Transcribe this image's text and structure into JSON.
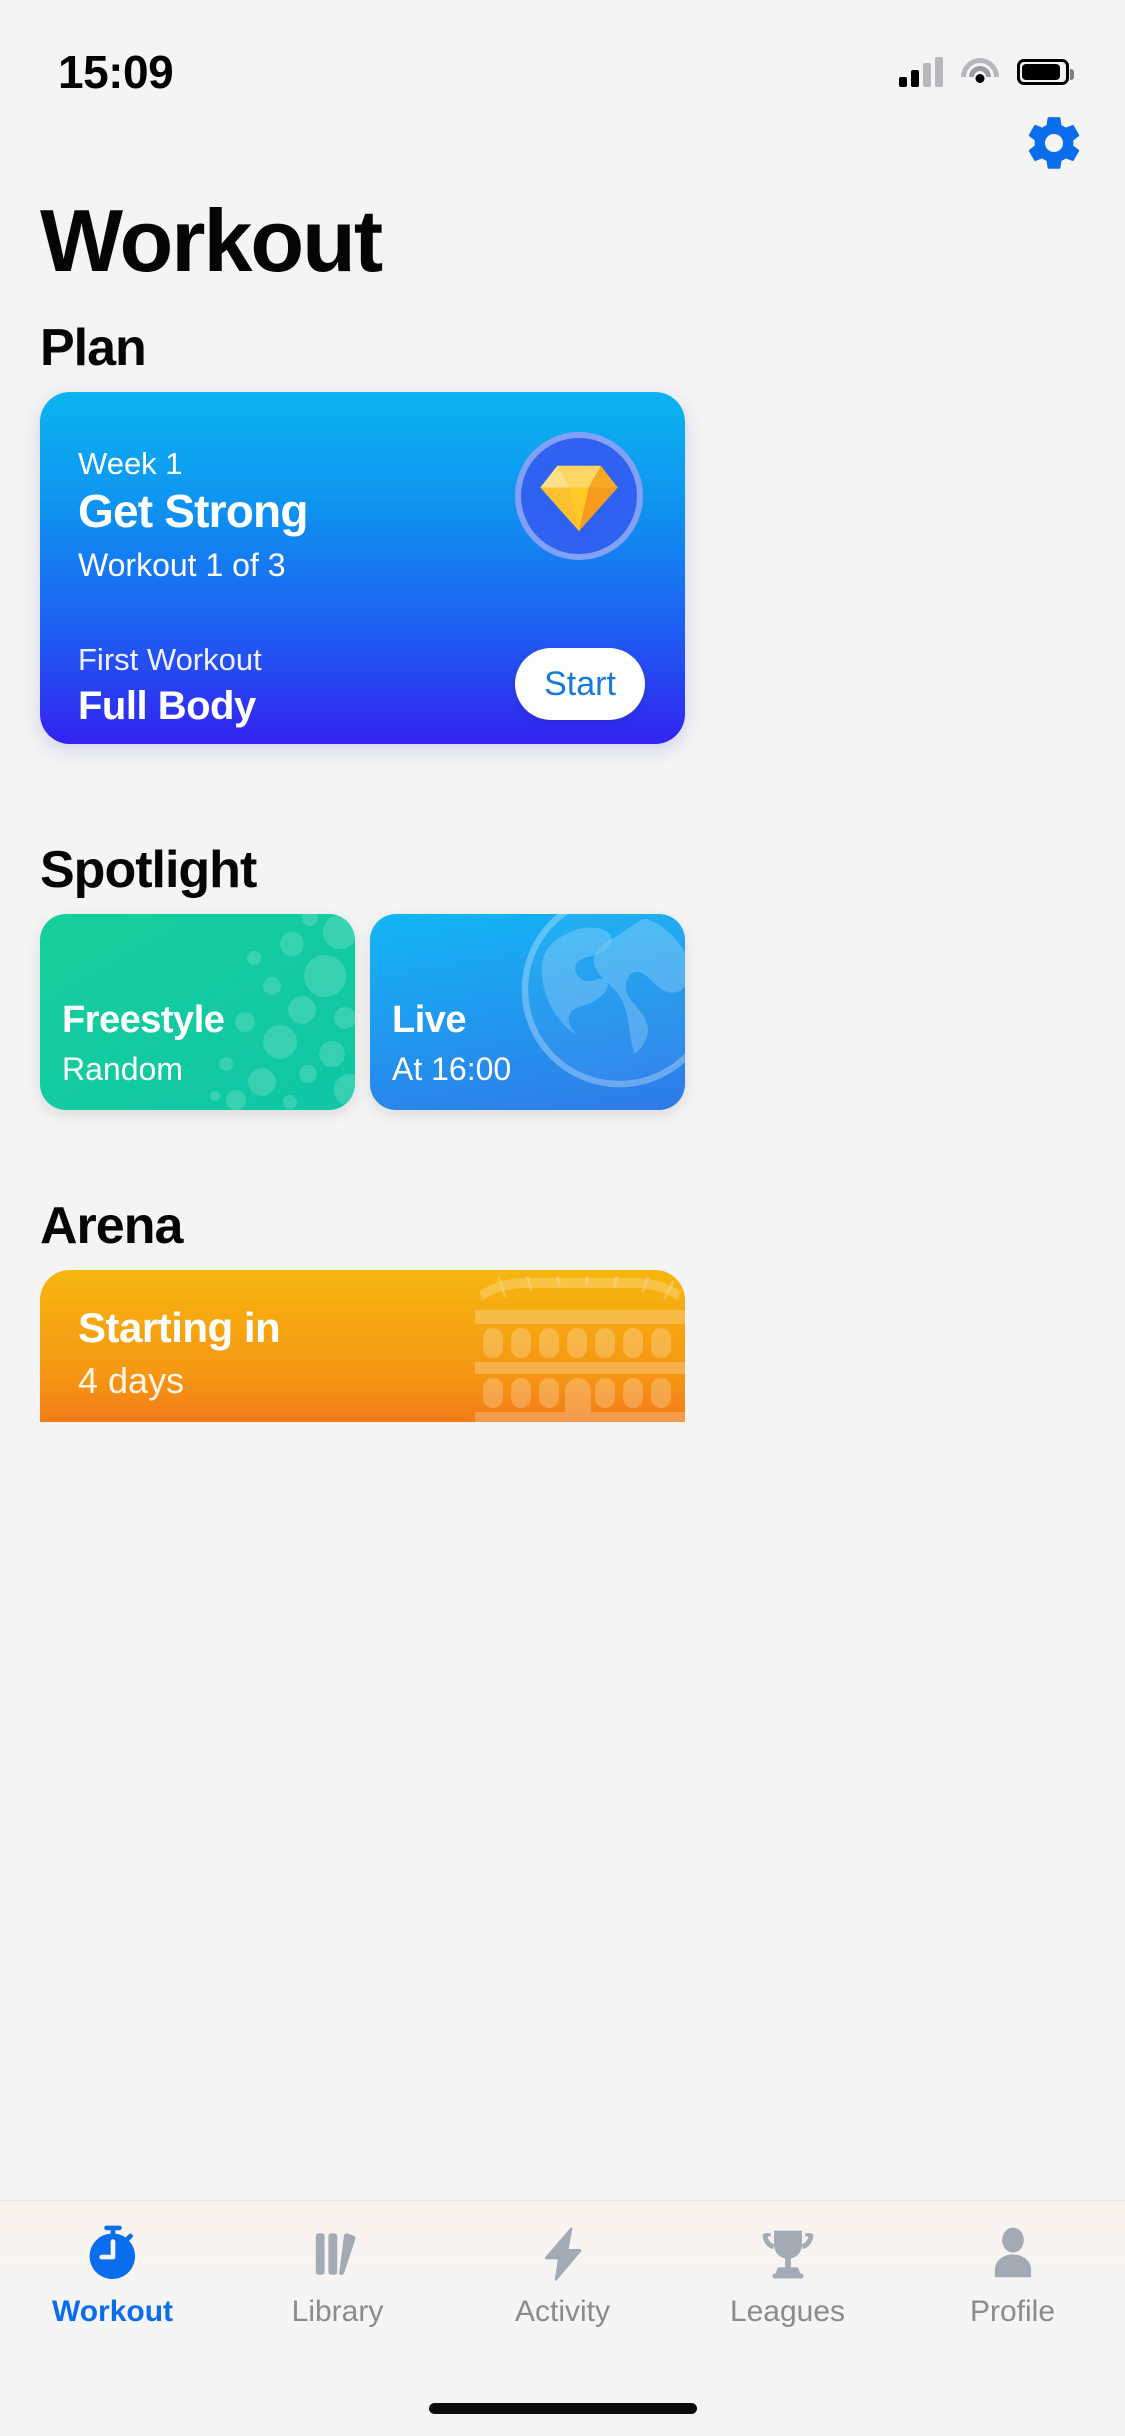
{
  "statusbar": {
    "time": "15:09",
    "cellular_icon": "signal-bars-icon",
    "wifi_icon": "wifi-icon",
    "battery_icon": "battery-icon"
  },
  "header": {
    "title": "Workout",
    "settings_icon": "gear-icon"
  },
  "sections": {
    "plan": {
      "heading": "Plan",
      "week": "Week 1",
      "name": "Get Strong",
      "progress": "Workout 1 of 3",
      "badge_icon": "diamond-gem-icon",
      "next_label": "First Workout",
      "next_name": "Full Body",
      "start_label": "Start"
    },
    "spotlight": {
      "heading": "Spotlight",
      "cards": [
        {
          "title": "Freestyle",
          "subtitle": "Random",
          "color": "#17CF9C",
          "art": "dots-pattern"
        },
        {
          "title": "Live",
          "subtitle": "At 16:00",
          "color": "#13B6F5",
          "art": "globe-icon"
        }
      ]
    },
    "arena": {
      "heading": "Arena",
      "title": "Starting in",
      "subtitle": "4 days",
      "art": "colosseum-icon",
      "color": "#F6B60F"
    }
  },
  "tabbar": {
    "active_color": "#0A6DEB",
    "inactive_color": "#8A8A8F",
    "items": [
      {
        "label": "Workout",
        "icon": "stopwatch-icon",
        "active": true
      },
      {
        "label": "Library",
        "icon": "books-icon",
        "active": false
      },
      {
        "label": "Activity",
        "icon": "lightning-bolt-icon",
        "active": false
      },
      {
        "label": "Leagues",
        "icon": "trophy-icon",
        "active": false
      },
      {
        "label": "Profile",
        "icon": "person-icon",
        "active": false
      }
    ]
  }
}
